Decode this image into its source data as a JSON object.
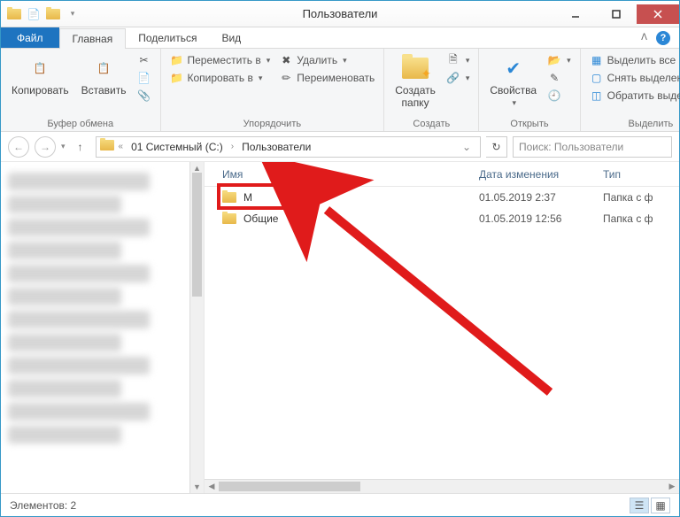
{
  "window": {
    "title": "Пользователи"
  },
  "tabs": {
    "file": "Файл",
    "home": "Главная",
    "share": "Поделиться",
    "view": "Вид"
  },
  "ribbon": {
    "clipboard": {
      "label": "Буфер обмена",
      "copy": "Копировать",
      "paste": "Вставить"
    },
    "organize": {
      "label": "Упорядочить",
      "move_to": "Переместить в",
      "copy_to": "Копировать в",
      "delete": "Удалить",
      "rename": "Переименовать"
    },
    "new": {
      "label": "Создать",
      "new_folder": "Создать\nпапку"
    },
    "open": {
      "label": "Открыть",
      "properties": "Свойства"
    },
    "select": {
      "label": "Выделить",
      "select_all": "Выделить все",
      "select_none": "Снять выделение",
      "invert": "Обратить выделение"
    }
  },
  "breadcrumb": {
    "seg1": "01 Системный (C:)",
    "seg2": "Пользователи"
  },
  "search": {
    "placeholder": "Поиск: Пользователи"
  },
  "columns": {
    "name": "Имя",
    "date": "Дата изменения",
    "type": "Тип"
  },
  "rows": [
    {
      "name": "M",
      "date": "01.05.2019 2:37",
      "type": "Папка с ф"
    },
    {
      "name": "Общие",
      "date": "01.05.2019 12:56",
      "type": "Папка с ф"
    }
  ],
  "status": {
    "items": "Элементов: 2"
  }
}
